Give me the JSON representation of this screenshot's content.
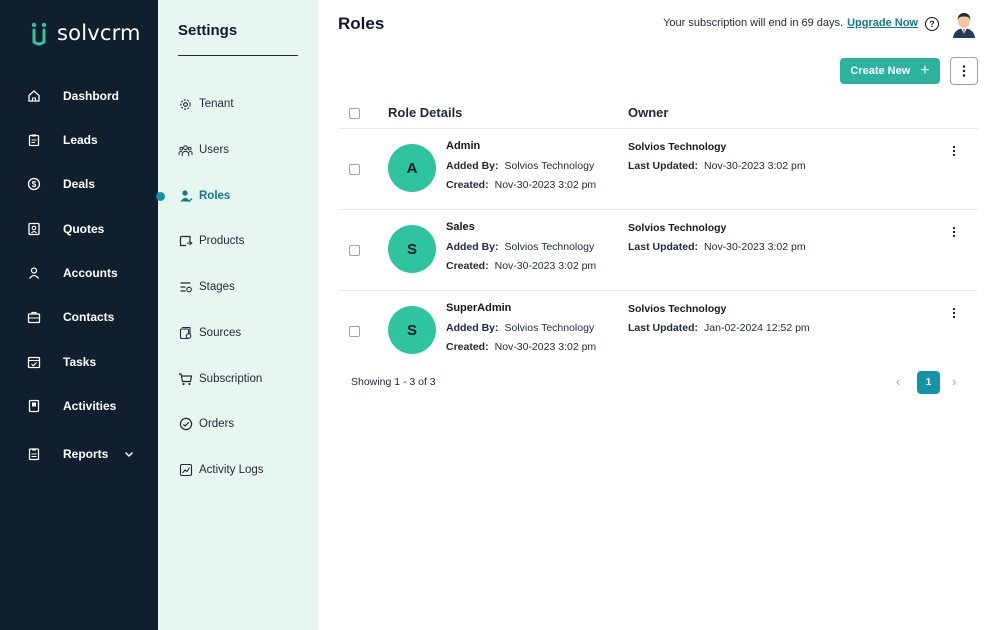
{
  "app": {
    "name": "solvcrm"
  },
  "nav": {
    "items": [
      {
        "label": "Dashbord",
        "icon": "home-icon"
      },
      {
        "label": "Leads",
        "icon": "clipboard-icon"
      },
      {
        "label": "Deals",
        "icon": "dollar-icon"
      },
      {
        "label": "Quotes",
        "icon": "quote-icon"
      },
      {
        "label": "Accounts",
        "icon": "user-icon"
      },
      {
        "label": "Contacts",
        "icon": "briefcase-icon"
      },
      {
        "label": "Tasks",
        "icon": "calendar-check-icon"
      },
      {
        "label": "Activities",
        "icon": "book-icon"
      },
      {
        "label": "Reports",
        "icon": "report-icon"
      }
    ]
  },
  "settings": {
    "title": "Settings",
    "items": [
      {
        "label": "Tenant",
        "icon": "gear-icon"
      },
      {
        "label": "Users",
        "icon": "users-icon"
      },
      {
        "label": "Roles",
        "icon": "user-check-icon",
        "active": true
      },
      {
        "label": "Products",
        "icon": "product-icon"
      },
      {
        "label": "Stages",
        "icon": "stages-icon"
      },
      {
        "label": "Sources",
        "icon": "sources-icon"
      },
      {
        "label": "Subscription",
        "icon": "cart-icon"
      },
      {
        "label": "Orders",
        "icon": "check-circle-icon"
      },
      {
        "label": "Activity Logs",
        "icon": "chart-icon"
      }
    ]
  },
  "header": {
    "title": "Roles",
    "subscription_text": "Your subscription will end in 69 days.",
    "upgrade_label": "Upgrade Now",
    "help_label": "?"
  },
  "toolbar": {
    "create_label": "Create New",
    "create_plus": "+"
  },
  "table": {
    "columns": [
      "Role Details",
      "Owner"
    ],
    "added_by_label": "Added By:",
    "created_label": "Created:",
    "updated_label": "Last Updated:",
    "rows": [
      {
        "initial": "A",
        "name": "Admin",
        "added_by": "Solvios Technology",
        "created": "Nov-30-2023 3:02 pm",
        "owner": "Solvios Technology",
        "updated": "Nov-30-2023 3:02 pm"
      },
      {
        "initial": "S",
        "name": "Sales",
        "added_by": "Solvios Technology",
        "created": "Nov-30-2023 3:02 pm",
        "owner": "Solvios Technology",
        "updated": "Nov-30-2023 3:02 pm"
      },
      {
        "initial": "S",
        "name": "SuperAdmin",
        "added_by": "Solvios Technology",
        "created": "Nov-30-2023 3:02 pm",
        "owner": "Solvios Technology",
        "updated": "Jan-02-2024 12:52 pm"
      }
    ]
  },
  "pagination": {
    "summary": "Showing 1 - 3 of 3",
    "prev": "‹",
    "current": "1",
    "next": "›"
  },
  "colors": {
    "nav_bg": "#0f1f2e",
    "settings_bg": "#e6f7ef",
    "accent": "#2bb39e",
    "avatar_circle": "#2ec4a0",
    "active": "#1493a8"
  }
}
